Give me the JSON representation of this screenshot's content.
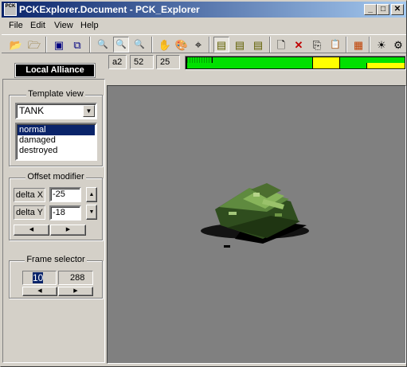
{
  "window": {
    "title": "PCKExplorer.Document - PCK_Explorer",
    "icon_label": "PCK"
  },
  "caption_buttons": {
    "minimize": "_",
    "maximize": "□",
    "close": "✕"
  },
  "menu": [
    "File",
    "Edit",
    "View",
    "Help"
  ],
  "toolbar": {
    "buttons": [
      {
        "icon": "open-folder-icon",
        "glyph": "📂"
      },
      {
        "icon": "open-file-icon",
        "glyph": "🗁"
      },
      {
        "icon": "import-icon",
        "glyph": "▣"
      },
      {
        "icon": "export-icon",
        "glyph": "⧉"
      },
      {
        "icon": "zoom-1x-icon",
        "glyph": "🔍"
      },
      {
        "icon": "zoom-2x-icon",
        "glyph": "🔍"
      },
      {
        "icon": "zoom-4x-icon",
        "glyph": "🔍"
      },
      {
        "icon": "hand-icon",
        "glyph": "✋"
      },
      {
        "icon": "palette-icon",
        "glyph": "🎨"
      },
      {
        "icon": "crosshair-icon",
        "glyph": "⌖"
      },
      {
        "icon": "layer-1-icon",
        "glyph": "▤"
      },
      {
        "icon": "layer-2-icon",
        "glyph": "▤"
      },
      {
        "icon": "layer-all-icon",
        "glyph": "▤"
      },
      {
        "icon": "new-document-icon",
        "glyph": "🗋"
      },
      {
        "icon": "delete-icon",
        "glyph": "✕"
      },
      {
        "icon": "copy-icon",
        "glyph": "⎘"
      },
      {
        "icon": "paste-icon",
        "glyph": "📋"
      },
      {
        "icon": "color-grid-icon",
        "glyph": "▦"
      },
      {
        "icon": "light-icon",
        "glyph": "☀"
      },
      {
        "icon": "settings-icon",
        "glyph": "⚙"
      }
    ]
  },
  "faction_label": "Local Alliance",
  "info": {
    "code": "a2",
    "value1": "52",
    "value2": "25"
  },
  "template_view": {
    "title": "Template view",
    "selected_type": "TANK",
    "states": [
      "normal",
      "damaged",
      "destroyed"
    ],
    "selected_state": "normal"
  },
  "offset_modifier": {
    "title": "Offset modifier",
    "delta_x_label": "delta X",
    "delta_x_value": "-25",
    "delta_y_label": "delta Y",
    "delta_y_value": "-18"
  },
  "frame_selector": {
    "title": "Frame selector",
    "current_frame": "10",
    "total_frames": "288"
  },
  "colors": {
    "title_start": "#0a246a",
    "title_end": "#a6caf0",
    "bar_green": "#00e000",
    "bar_yellow": "#ffff00",
    "canvas": "#808080"
  }
}
